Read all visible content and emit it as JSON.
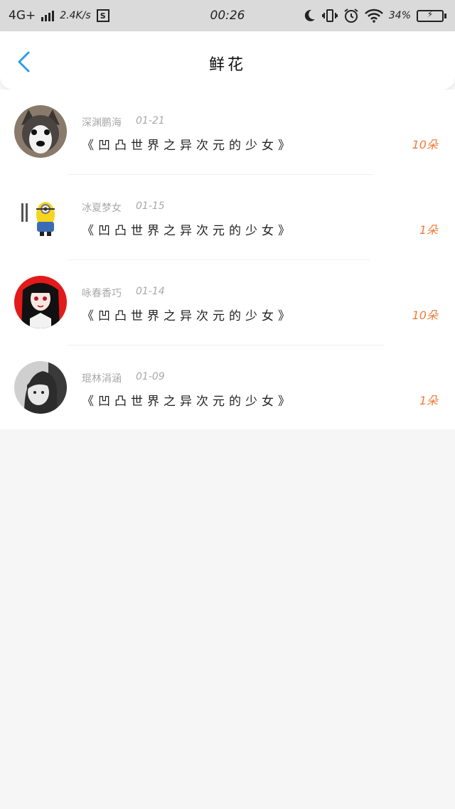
{
  "status_bar": {
    "network": "4G+",
    "speed": "2.4K/s",
    "sim": "S",
    "time": "00:26",
    "battery": "34%"
  },
  "nav": {
    "title": "鲜花"
  },
  "colors": {
    "accent": "#2f9bea",
    "count": "#f07a36"
  },
  "items": [
    {
      "name": "深渊鹏海",
      "date": "01-21",
      "content": "《凹凸世界之异次元的少女》",
      "count": "10朵",
      "avatar": "husky-dog-avatar"
    },
    {
      "name": "冰夏梦女",
      "date": "01-15",
      "content": "《凹凸世界之异次元的少女》",
      "count": "1朵",
      "avatar": "minion-avatar"
    },
    {
      "name": "咏春香巧",
      "date": "01-14",
      "content": "《凹凸世界之异次元的少女》",
      "count": "10朵",
      "avatar": "anime-girl-avatar"
    },
    {
      "name": "琨林涓涵",
      "date": "01-09",
      "content": "《凹凸世界之异次元的少女》",
      "count": "1朵",
      "avatar": "portrait-avatar"
    }
  ]
}
